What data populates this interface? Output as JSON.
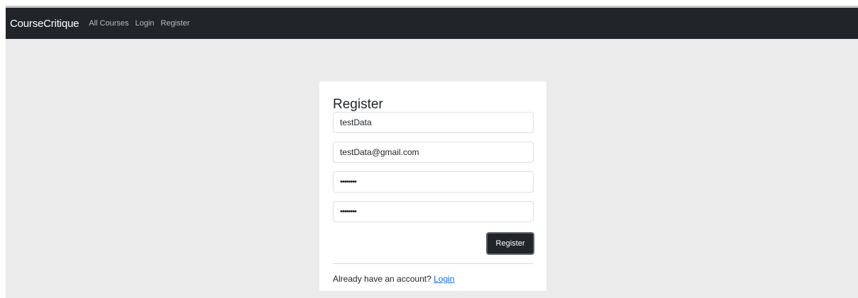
{
  "navbar": {
    "brand": "CourseCritique",
    "links": [
      {
        "label": "All Courses"
      },
      {
        "label": "Login"
      },
      {
        "label": "Register"
      }
    ]
  },
  "register_form": {
    "title": "Register",
    "username_value": "testData",
    "email_value": "testData@gmail.com",
    "password_value": "••••••••",
    "confirm_password_value": "••••••••",
    "submit_label": "Register",
    "footer_text": "Already have an account?",
    "footer_link": "Login"
  },
  "colors": {
    "navbar_bg": "#212529",
    "page_bg": "#ecebeb",
    "card_bg": "#ffffff",
    "button_bg": "#212529",
    "link": "#0d6efd"
  }
}
